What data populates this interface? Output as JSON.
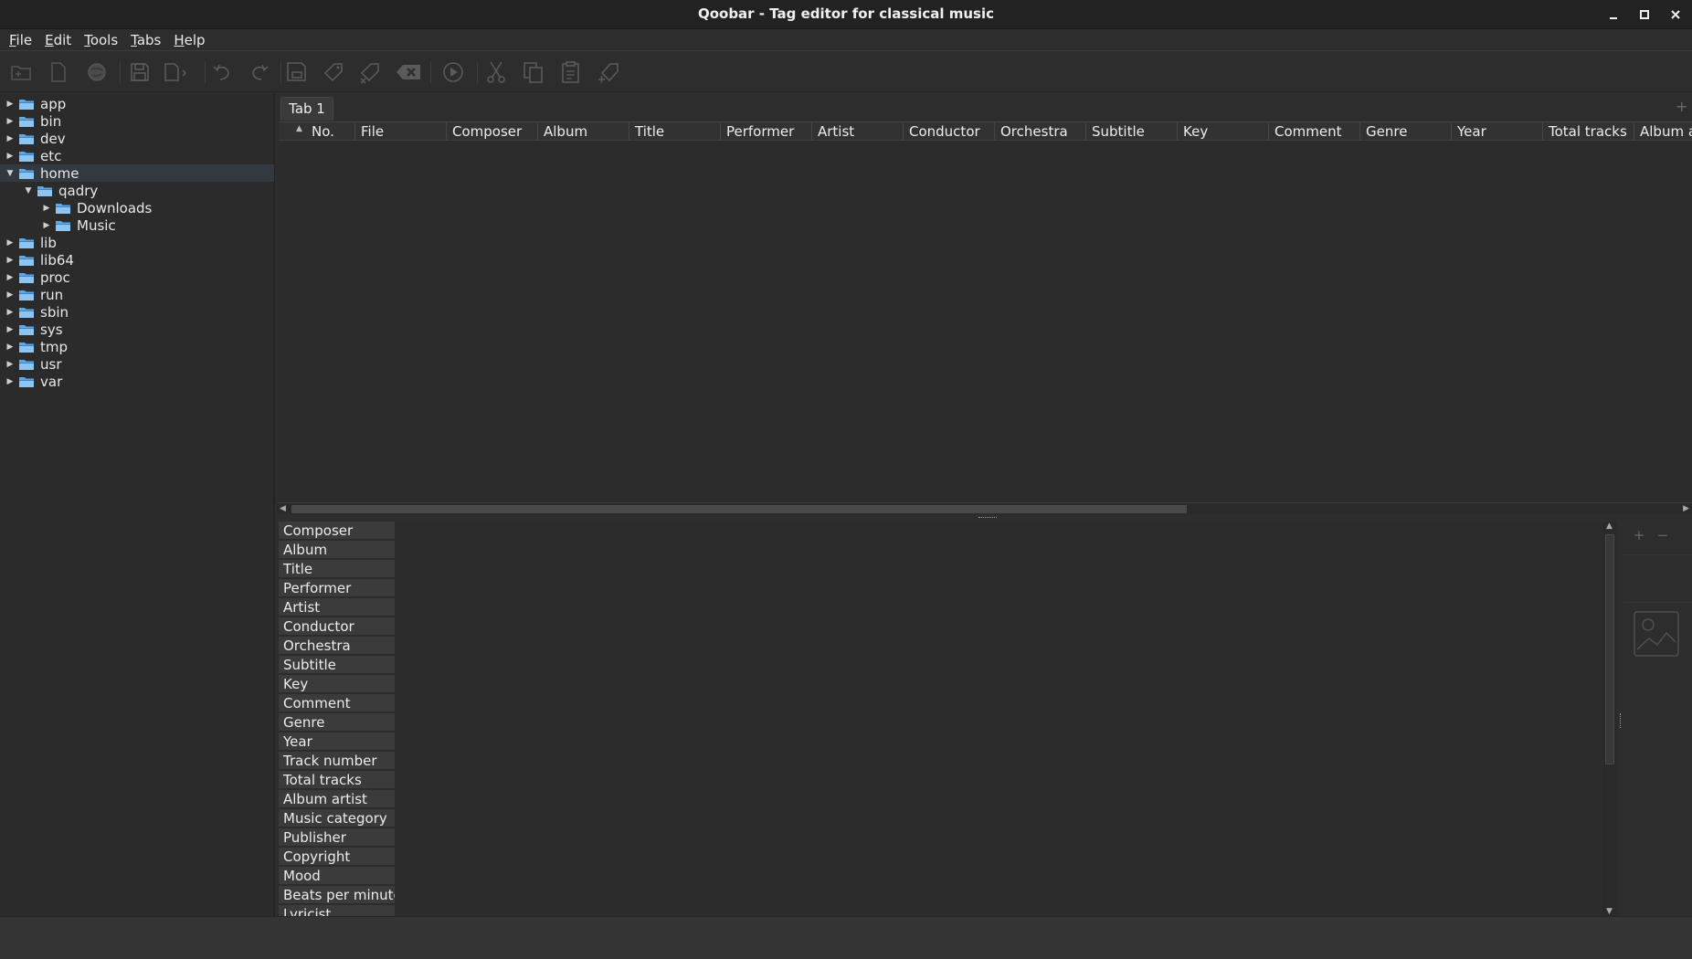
{
  "window": {
    "title": "Qoobar - Tag editor for classical music"
  },
  "menu": [
    "File",
    "Edit",
    "Tools",
    "Tabs",
    "Help"
  ],
  "toolbar": {
    "icons": [
      "add-folder-icon",
      "new-file-icon",
      "globe-icon",
      "save-icon",
      "save-as-icon",
      "undo-icon",
      "redo-icon",
      "save-tags-icon",
      "tag-icon",
      "remove-tag-icon",
      "clear-icon",
      "play-icon",
      "cut-icon",
      "copy-icon",
      "paste-icon",
      "tag-add-icon"
    ]
  },
  "tree": [
    {
      "label": "app",
      "depth": 0,
      "expanded": false
    },
    {
      "label": "bin",
      "depth": 0,
      "expanded": false
    },
    {
      "label": "dev",
      "depth": 0,
      "expanded": false
    },
    {
      "label": "etc",
      "depth": 0,
      "expanded": false
    },
    {
      "label": "home",
      "depth": 0,
      "expanded": true,
      "selected": true
    },
    {
      "label": "qadry",
      "depth": 1,
      "expanded": true
    },
    {
      "label": "Downloads",
      "depth": 2,
      "expanded": false
    },
    {
      "label": "Music",
      "depth": 2,
      "expanded": false
    },
    {
      "label": "lib",
      "depth": 0,
      "expanded": false
    },
    {
      "label": "lib64",
      "depth": 0,
      "expanded": false
    },
    {
      "label": "proc",
      "depth": 0,
      "expanded": false
    },
    {
      "label": "run",
      "depth": 0,
      "expanded": false
    },
    {
      "label": "sbin",
      "depth": 0,
      "expanded": false
    },
    {
      "label": "sys",
      "depth": 0,
      "expanded": false
    },
    {
      "label": "tmp",
      "depth": 0,
      "expanded": false
    },
    {
      "label": "usr",
      "depth": 0,
      "expanded": false
    },
    {
      "label": "var",
      "depth": 0,
      "expanded": false
    }
  ],
  "tabs": [
    {
      "label": "Tab 1"
    }
  ],
  "tab_add": "+",
  "table": {
    "columns": [
      "No.",
      "File",
      "Composer",
      "Album",
      "Title",
      "Performer",
      "Artist",
      "Conductor",
      "Orchestra",
      "Subtitle",
      "Key",
      "Comment",
      "Genre",
      "Year",
      "Total tracks",
      "Album artist"
    ],
    "rows": []
  },
  "tags": [
    "Composer",
    "Album",
    "Title",
    "Performer",
    "Artist",
    "Conductor",
    "Orchestra",
    "Subtitle",
    "Key",
    "Comment",
    "Genre",
    "Year",
    "Track number",
    "Total tracks",
    "Album artist",
    "Music category",
    "Publisher",
    "Copyright",
    "Mood",
    "Beats per minute",
    "Lyricist"
  ],
  "right_panel": {
    "add": "+",
    "remove": "−"
  },
  "colors": {
    "background": "#2d2d2d",
    "folder_blue": "#5fa8e8",
    "selection": "#333941"
  }
}
